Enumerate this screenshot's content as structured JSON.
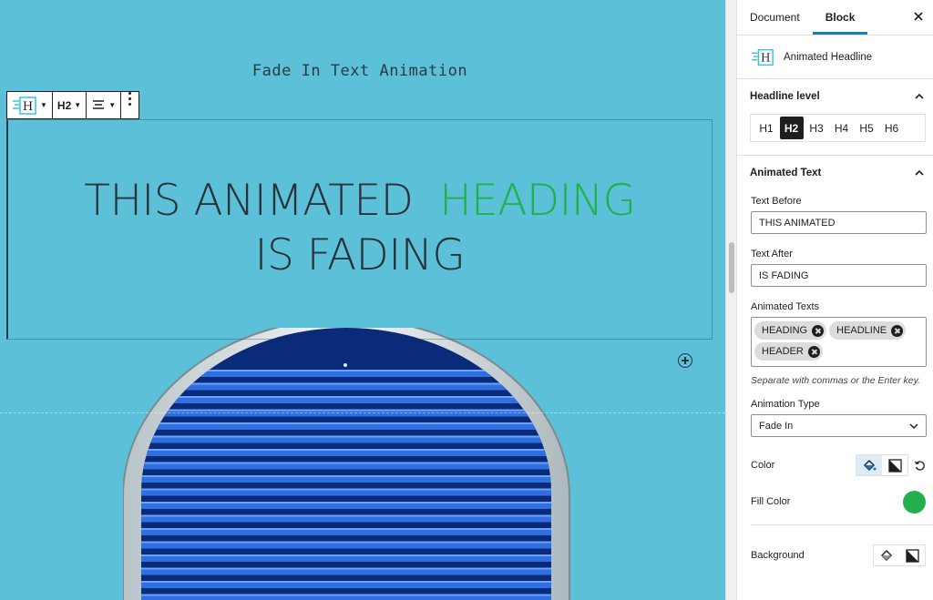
{
  "canvas": {
    "subtitle": "Fade In Text Animation",
    "headline": {
      "before": "THIS ANIMATED",
      "animated": "HEADING",
      "after": "IS FADING"
    },
    "toolbar": {
      "level_label": "H2"
    }
  },
  "sidebar": {
    "tabs": [
      {
        "label": "Document"
      },
      {
        "label": "Block"
      }
    ],
    "active_tab": "Block",
    "block_name": "Animated Headline",
    "headline_level": {
      "title": "Headline level",
      "levels": [
        "H1",
        "H2",
        "H3",
        "H4",
        "H5",
        "H6"
      ],
      "active": "H2"
    },
    "animated_text": {
      "title": "Animated Text",
      "text_before_label": "Text Before",
      "text_before_value": "THIS ANIMATED",
      "text_after_label": "Text After",
      "text_after_value": "IS FADING",
      "animated_texts_label": "Animated Texts",
      "tokens": [
        "HEADING",
        "HEADLINE",
        "HEADER"
      ],
      "help": "Separate with commas or the Enter key.",
      "animation_type_label": "Animation Type",
      "animation_type_value": "Fade In",
      "color_label": "Color",
      "fill_color_label": "Fill Color",
      "fill_color": "#22b04a",
      "background_label": "Background"
    }
  },
  "colors": {
    "canvas_bg": "#5bc0d8",
    "accent_green": "#22b04a",
    "tab_indicator": "#1a7fb8"
  }
}
